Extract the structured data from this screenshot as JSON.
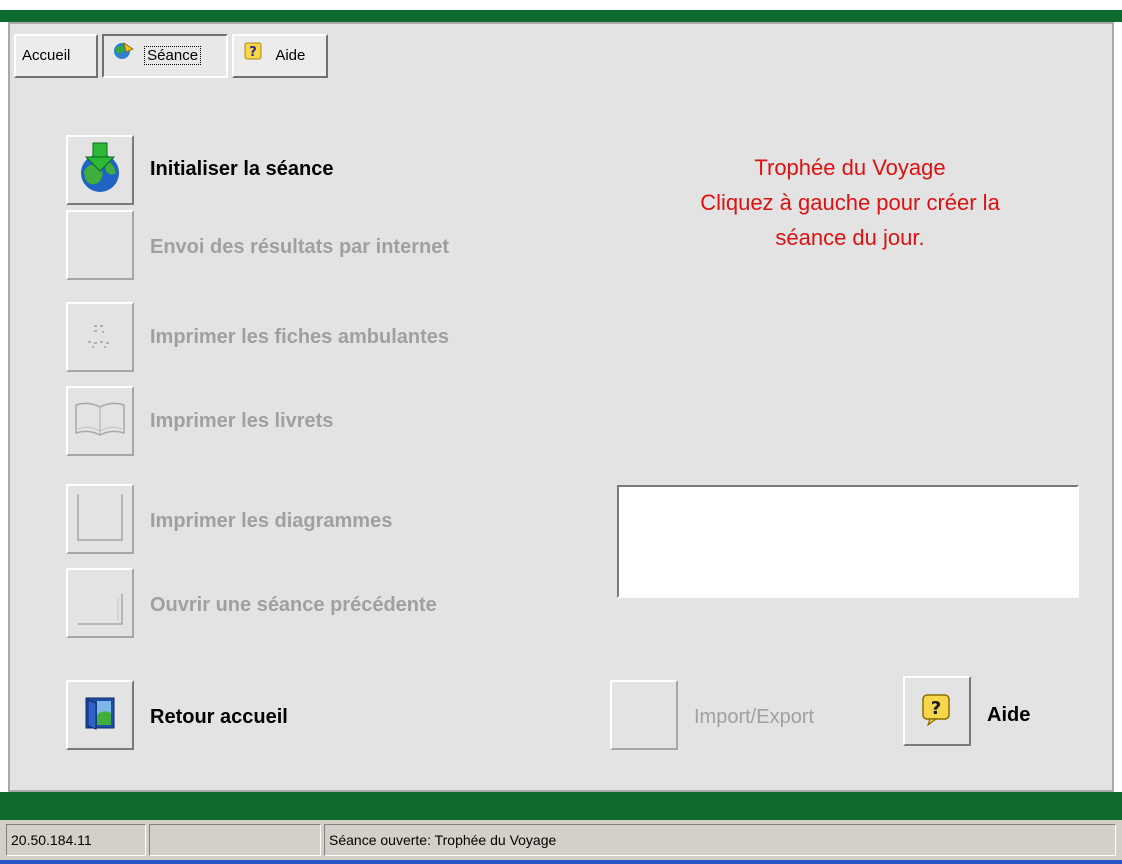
{
  "tabs": {
    "accueil": "Accueil",
    "seance": "Séance",
    "aide": "Aide"
  },
  "actions": {
    "initialiser": "Initialiser la séance",
    "envoi": "Envoi des résultats par internet",
    "fiches": "Imprimer les fiches ambulantes",
    "livrets": "Imprimer les livrets",
    "diagrammes": "Imprimer les diagrammes",
    "ouvrir": "Ouvrir une séance précédente",
    "retour": "Retour accueil",
    "import_export": "Import/Export",
    "aide": "Aide"
  },
  "message": {
    "line1": "Trophée du Voyage",
    "line2": "Cliquez à gauche pour créer la",
    "line3": "séance du jour."
  },
  "status": {
    "ip": "20.50.184.11",
    "middle": "",
    "text": "Séance ouverte: Trophée du Voyage"
  },
  "colors": {
    "green_band": "#0f6b2f",
    "message_red": "#dd1111",
    "disabled_text": "#a0a0a0"
  },
  "icons": {
    "seance_tab": "globe-icon",
    "aide_tab": "help-icon",
    "initialiser": "globe-download-icon",
    "fiches": "dots-icon",
    "livrets": "open-book-icon",
    "diagrammes": "diagram-frame-icon",
    "ouvrir": "folder-corner-icon",
    "retour": "door-exit-icon",
    "aide": "help-bubble-icon"
  }
}
